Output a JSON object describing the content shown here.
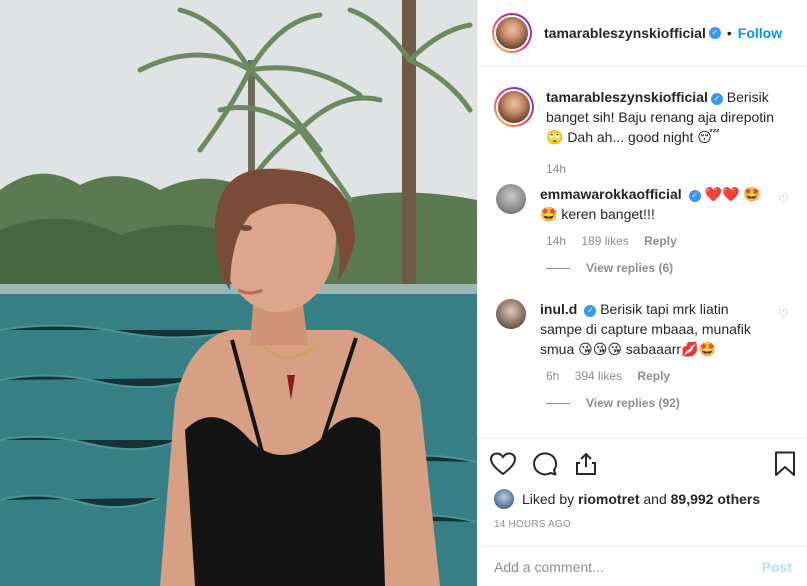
{
  "post": {
    "author": "tamarableszynskiofficial",
    "follow_label": "Follow",
    "separator": "•",
    "caption_text": "Berisik banget sih! Baju renang aja direpotin 🙄 Dah ah... good night 😴",
    "caption_age": "14h"
  },
  "comments": [
    {
      "username": "emmawarokkaofficial",
      "text": "❤️❤️ 🤩🤩 keren banget!!!",
      "age": "14h",
      "likes": "189 likes",
      "reply_label": "Reply",
      "view_replies": "View replies (6)"
    },
    {
      "username": "inul.d",
      "text": "Berisik tapi mrk liatin sampe di capture mbaaa, munafik smua 😘😘😘 sabaaarr💋🤩",
      "age": "6h",
      "likes": "394 likes",
      "reply_label": "Reply",
      "view_replies": "View replies (92)"
    }
  ],
  "likes": {
    "prefix": "Liked by",
    "user": "riomotret",
    "middle": "and",
    "others": "89,992 others"
  },
  "timestamp": "14 HOURS AGO",
  "add_comment": {
    "placeholder": "Add a comment...",
    "post_label": "Post"
  },
  "icons": {
    "like": "heart-icon",
    "comment": "comment-icon",
    "share": "share-icon",
    "save": "bookmark-icon",
    "verified": "verified-badge-icon"
  },
  "colors": {
    "accent": "#0095f6",
    "verified": "#3897f0",
    "muted": "#8e8e8e",
    "post_disabled": "#b2dffc"
  }
}
